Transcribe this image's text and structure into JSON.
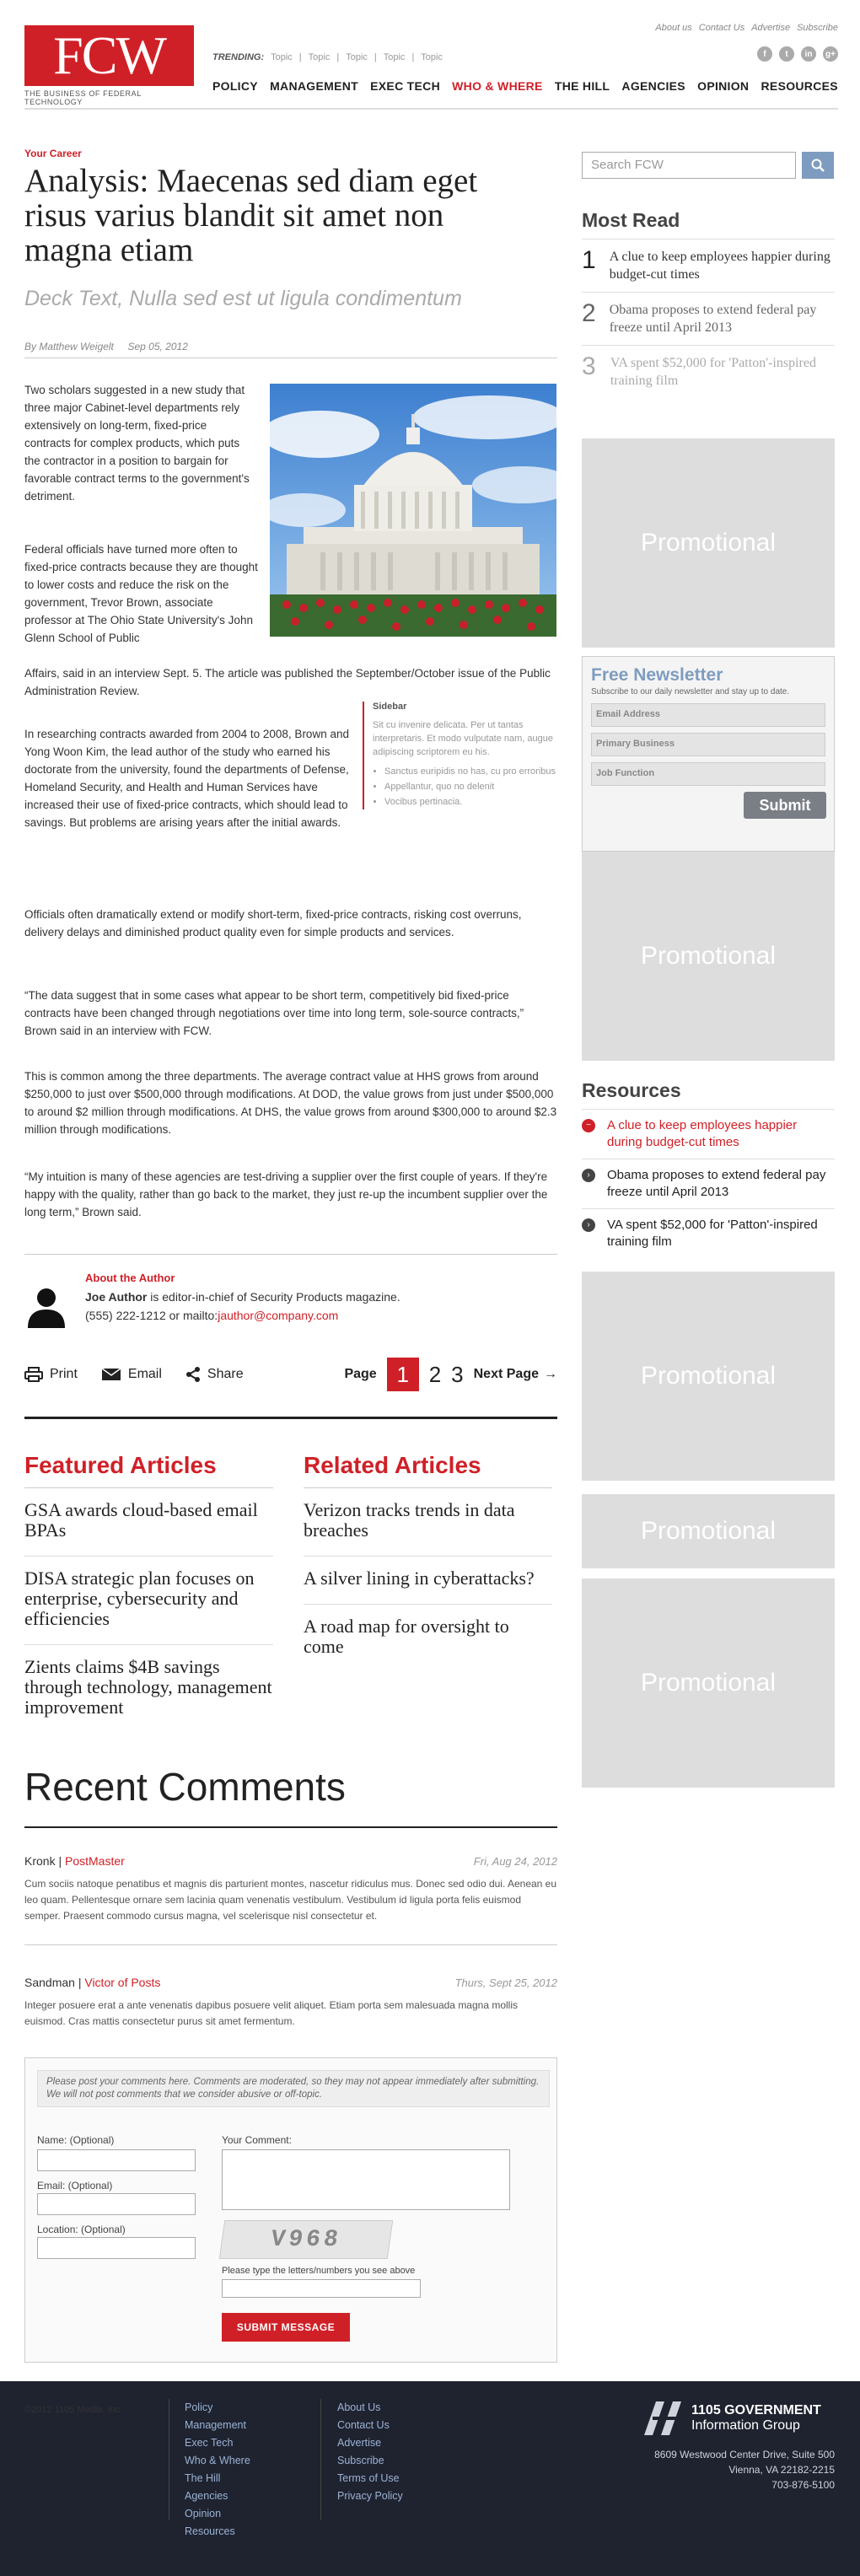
{
  "header": {
    "logo_text": "FCW",
    "logo_tagline": "THE BUSINESS OF FEDERAL TECHNOLOGY",
    "top_links": [
      "About us",
      "Contact Us",
      "Advertise",
      "Subscribe"
    ],
    "trending_label": "TRENDING:",
    "trending": [
      "Topic",
      "Topic",
      "Topic",
      "Topic",
      "Topic"
    ],
    "nav": [
      "POLICY",
      "MANAGEMENT",
      "EXEC TECH",
      "WHO & WHERE",
      "THE HILL",
      "AGENCIES",
      "OPINION",
      "RESOURCES"
    ],
    "social_icons": [
      "facebook-icon",
      "twitter-icon",
      "linkedin-icon",
      "googleplus-icon"
    ],
    "accent": "#d02027"
  },
  "article": {
    "kicker": "Your Career",
    "title": "Analysis: Maecenas sed diam eget risus varius blandit sit amet non magna etiam",
    "deck": "Deck Text, Nulla sed est ut ligula condimentum",
    "author": "By Matthew Weigelt",
    "date": "Sep 05, 2012",
    "p1": "Two scholars suggested in a new study that three major Cabinet-level departments rely extensively on long-term, fixed-price contracts for complex products, which puts the contractor in a position to bargain for favorable contract terms to the government's detriment.",
    "p2a": "Federal officials have turned more often to fixed-price contracts because they are thought to lower costs and reduce the risk on the government, Trevor Brown, associate professor at The Ohio State University's John Glenn School of Public",
    "p2b": "Affairs, said in an interview Sept. 5. The article was published the September/October issue of the Public Administration Review.",
    "p3": "In researching contracts awarded from 2004 to 2008, Brown and Yong Woon Kim, the lead author of the study who earned his doctorate from the university, found the departments of Defense, Homeland Security, and Health and Human Services have increased their use of fixed-price contracts, which should lead to savings. But problems are arising years after the initial awards.",
    "p4": "Officials often dramatically extend or modify short-term, fixed-price contracts, risking cost overruns, delivery delays and diminished product quality even for simple products and services.",
    "p5": "“The data suggest that in some cases what appear to be short term, competitively bid fixed-price contracts have been changed through negotiations over time into long term, sole-source contracts,” Brown said in an interview with FCW.",
    "p6": "This is common among the three departments. The average contract value at HHS grows from around $250,000 to just over $500,000 through modifications. At DOD, the value grows from just under $500,000 to around $2 million through modifications. At DHS, the value grows from around $300,000 to around $2.3 million through modifications.",
    "p7": "“My intuition is many of these agencies are test-driving a supplier over the first couple of years. If they're happy with the quality, rather than go back to the market, they just re-up the incumbent supplier over the long term,” Brown said.",
    "sidebar": {
      "title": "Sidebar",
      "text": "Sit cu invenire delicata. Per ut tantas interpretaris. Et modo vulputate nam, augue adipiscing scriptorem eu his.",
      "bullets": [
        "Sanctus euripidis no has, cu pro erroribus",
        "Appellantur, quo no delenit",
        "Vocibus pertinacia."
      ]
    },
    "about": {
      "heading": "About the Author",
      "name": "Joe Author",
      "bio": " is editor-in-chief of Security Products magazine.",
      "contact_prefix": "(555) 222-1212 or mailto:",
      "email": "jauthor@company.com"
    },
    "tools": {
      "print": "Print",
      "email": "Email",
      "share": "Share"
    },
    "pager": {
      "label": "Page",
      "current": "1",
      "pages": [
        "2",
        "3"
      ],
      "next": "Next Page"
    }
  },
  "featured": {
    "heading": "Featured Articles",
    "items": [
      "GSA awards cloud-based email BPAs",
      "DISA strategic plan focuses on enterprise, cybersecurity and efficiencies",
      "Zients claims $4B savings through technology, management improvement"
    ]
  },
  "related": {
    "heading": "Related Articles",
    "items": [
      "Verizon tracks trends in data breaches",
      "A silver lining in cyberattacks?",
      "A road map for oversight to come"
    ]
  },
  "comments": {
    "heading": "Recent Comments",
    "items": [
      {
        "name": "Kronk",
        "role": "PostMaster",
        "date": "Fri, Aug 24, 2012",
        "text": "Cum sociis natoque penatibus et magnis dis parturient montes, nascetur ridiculus mus. Donec sed odio dui. Aenean eu leo quam. Pellentesque ornare sem lacinia quam venenatis vestibulum. Vestibulum id ligula porta felis euismod semper. Praesent commodo cursus magna, vel scelerisque nisl consectetur et."
      },
      {
        "name": "Sandman",
        "role": "Victor of Posts",
        "date": "Thurs, Sept 25, 2012",
        "text": "Integer posuere erat a ante venenatis dapibus posuere velit aliquet. Etiam porta sem malesuada magna mollis euismod. Cras mattis consectetur purus sit amet fermentum."
      }
    ],
    "form": {
      "notice": "Please post your comments here. Comments are moderated, so they may not appear immediately after submitting. We will not post comments that we consider abusive or off-topic.",
      "name_label": "Name: (Optional)",
      "email_label": "Email: (Optional)",
      "location_label": "Location: (Optional)",
      "comment_label": "Your Comment:",
      "captcha_text": "V968",
      "captcha_label": "Please type the letters/numbers you see above",
      "submit": "SUBMIT MESSAGE"
    }
  },
  "rightcol": {
    "search_placeholder": "Search FCW",
    "most_read": {
      "heading": "Most Read",
      "items": [
        {
          "n": "1",
          "text": "A clue to keep employees happier during budget-cut times"
        },
        {
          "n": "2",
          "text": "Obama proposes to extend federal pay freeze until April 2013"
        },
        {
          "n": "3",
          "text": "VA spent $52,000 for 'Patton'-inspired training film"
        }
      ]
    },
    "promo": "Promotional",
    "newsletter": {
      "title": "Free Newsletter",
      "sub": "Subscribe to our daily newsletter and stay up to date.",
      "fields": [
        "Email Address",
        "Primary Business",
        "Job Function"
      ],
      "button": "Submit"
    },
    "resources": {
      "heading": "Resources",
      "items": [
        "A clue to keep employees happier during budget-cut times",
        "Obama proposes to extend federal pay freeze until April 2013",
        "VA spent $52,000 for 'Patton'-inspired training film"
      ]
    }
  },
  "footer": {
    "copyright": "©2012 1105 Media, Inc.",
    "col1": [
      "Policy",
      "Management",
      "Exec Tech",
      "Who & Where",
      "The Hill",
      "Agencies",
      "Opinion",
      "Resources"
    ],
    "col2": [
      "About Us",
      "Contact Us",
      "Advertise",
      "Subscribe",
      "Terms of Use",
      "Privacy Policy"
    ],
    "logo_line1": "1105 GOVERNMENT",
    "logo_line2": "Information Group",
    "address": [
      "8609 Westwood Center Drive, Suite 500",
      "Vienna, VA 22182-2215",
      "703-876-5100"
    ]
  }
}
